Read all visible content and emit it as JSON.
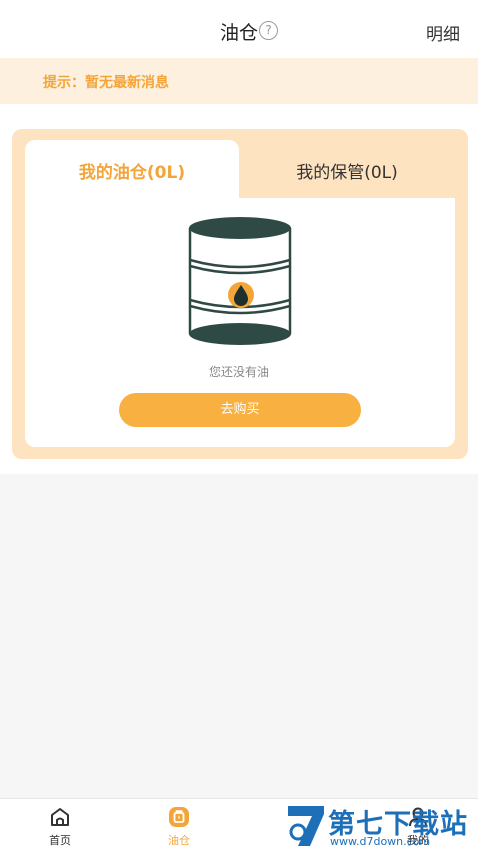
{
  "header": {
    "title": "油仓",
    "help_icon": "question-circle-icon",
    "detail_label": "明细"
  },
  "notice": {
    "text": "提示：暂无最新消息"
  },
  "tabs": [
    {
      "label": "我的油仓(0L)",
      "active": true
    },
    {
      "label": "我的保管(0L)",
      "active": false
    }
  ],
  "empty_state": {
    "icon": "oil-barrel-icon",
    "text": "您还没有油",
    "button_label": "去购买"
  },
  "tabbar": {
    "items": [
      {
        "label": "首页",
        "icon": "home-icon",
        "active": false
      },
      {
        "label": "油仓",
        "icon": "oil-tank-icon",
        "active": true
      },
      {
        "label": "我的",
        "icon": "user-icon",
        "active": false
      }
    ]
  },
  "watermark": {
    "brand": "第七下载站",
    "url": "www.d7down.com"
  },
  "colors": {
    "accent": "#f4a53a",
    "button": "#f8b040",
    "card_bg": "#fde3c0",
    "notice_bg": "#fdf0de",
    "barrel": "#2f4a45"
  }
}
